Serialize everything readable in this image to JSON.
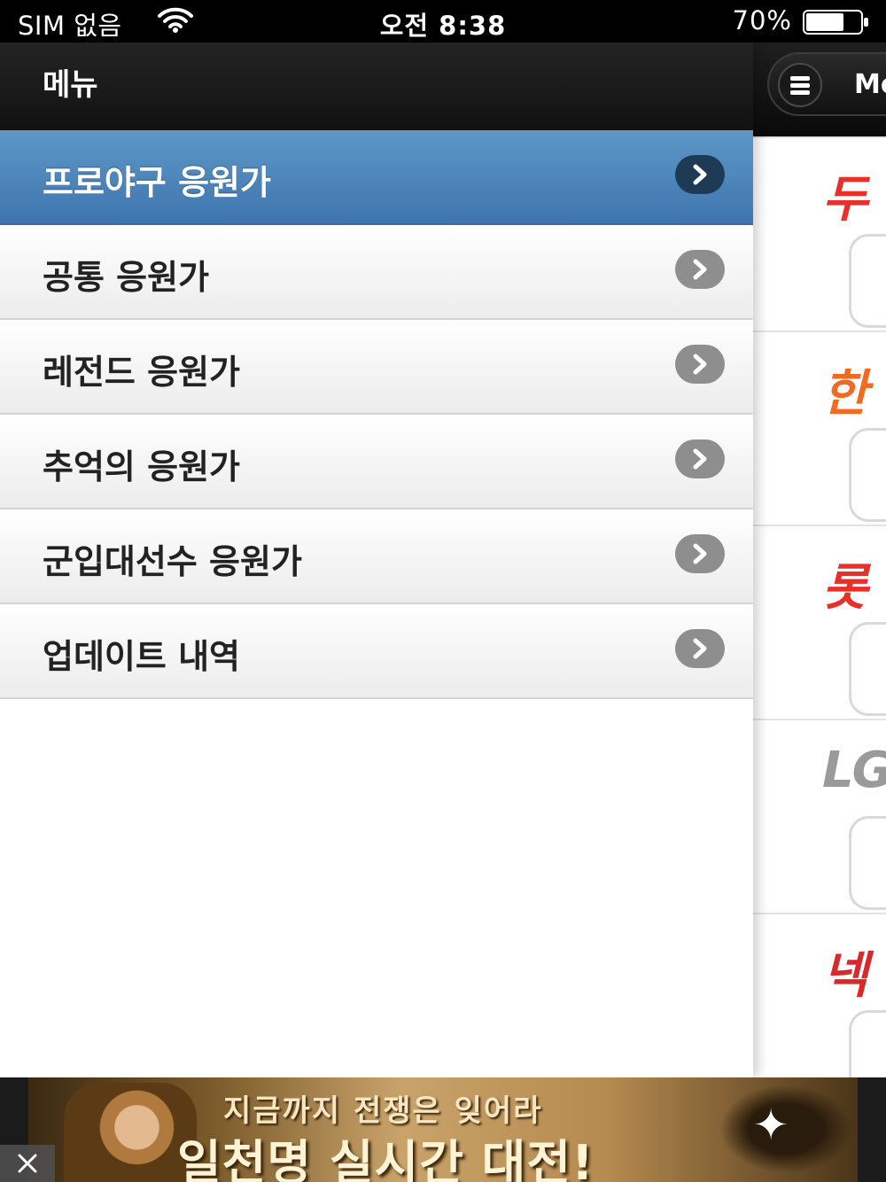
{
  "status_bar": {
    "carrier": "SIM 없음",
    "time": "오전 8:38",
    "battery_percent": "70%",
    "battery_level": 0.7
  },
  "main_page": {
    "menu_button_label": "Me",
    "teams": [
      {
        "name": "두",
        "color": "#e8302a"
      },
      {
        "name": "한",
        "color": "#f26a21"
      },
      {
        "name": "롯",
        "color": "#e8302a"
      },
      {
        "name": "LG",
        "color": "#9a9a9a"
      },
      {
        "name": "넥",
        "color": "#d8282a"
      }
    ]
  },
  "panel": {
    "title": "메뉴",
    "items": [
      {
        "label": "프로야구 응원가",
        "active": true
      },
      {
        "label": "공통 응원가",
        "active": false
      },
      {
        "label": "레전드 응원가",
        "active": false
      },
      {
        "label": "추억의 응원가",
        "active": false
      },
      {
        "label": "군입대선수 응원가",
        "active": false
      },
      {
        "label": "업데이트 내역",
        "active": false
      }
    ]
  },
  "ad": {
    "line1": "지금까지 전쟁은 잊어라",
    "line2": "일천명 실시간 대전!"
  },
  "icons": {
    "wifi": "wifi-icon",
    "battery": "battery-icon",
    "menu": "hamburger-icon",
    "item_arrow": "chevron-right-icon",
    "close": "close-icon"
  }
}
